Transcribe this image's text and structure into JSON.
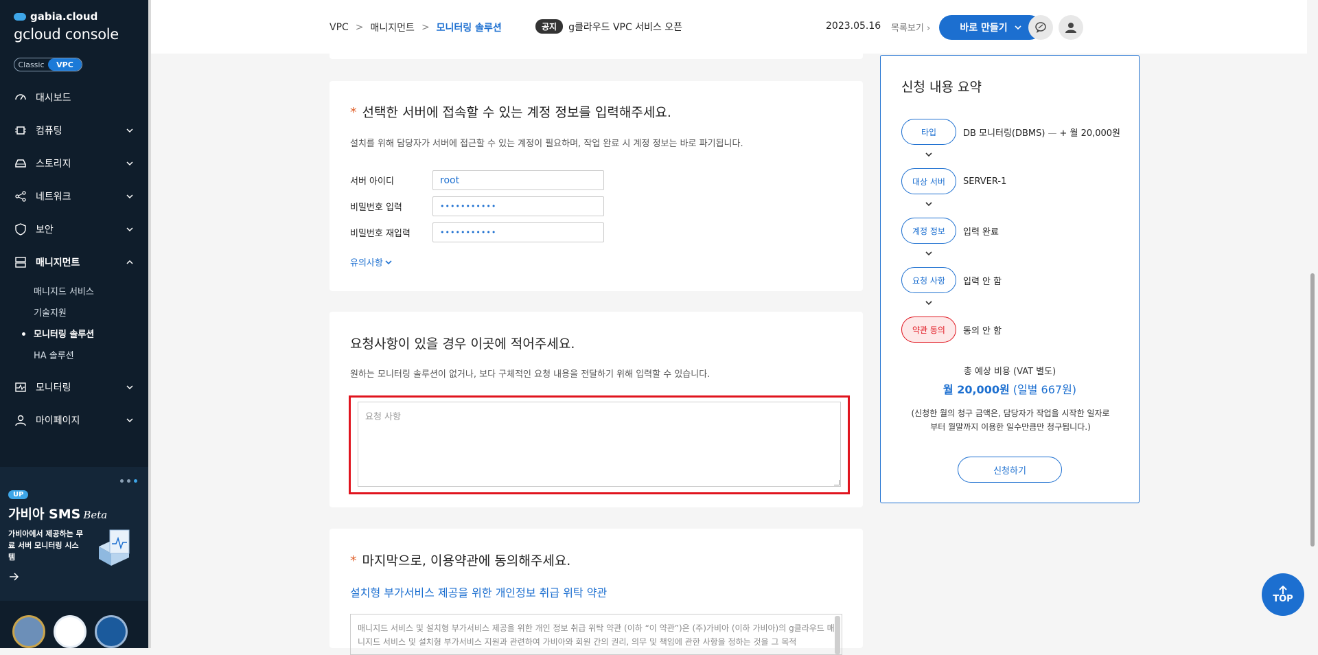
{
  "sidebar": {
    "brand": "gabia.cloud",
    "console": "gcloud console",
    "toggle": {
      "classic": "Classic",
      "vpc": "VPC"
    },
    "nav": {
      "dashboard": "대시보드",
      "computing": "컴퓨팅",
      "storage": "스토리지",
      "network": "네트워크",
      "security": "보안",
      "managed": "매니지먼트",
      "monitoring": "모니터링",
      "mypage": "마이페이지"
    },
    "sub": {
      "managed_service": "매니지드 서비스",
      "tech_support": "기술지원",
      "monitoring_solution": "모니터링 솔루션",
      "ha_solution": "HA 솔루션"
    },
    "promo": {
      "badge": "UP",
      "title": "가비아 SMS",
      "title_suffix": "Beta",
      "desc": "가비아에서 제공하는 무료 서버 모니터링 시스템"
    }
  },
  "topbar": {
    "breadcrumb": {
      "vpc": "VPC",
      "management": "매니지먼트",
      "current": "모니터링 솔루션",
      "sep": ">"
    },
    "notice_tag": "공지",
    "notice_text": "g클라우드 VPC 서비스 오픈",
    "date": "2023.05.16",
    "list_link": "목록보기",
    "make_button": "바로 만들기"
  },
  "account": {
    "title": "선택한 서버에 접속할 수 있는 계정 정보를 입력해주세요.",
    "required_mark": "*",
    "desc": "설치를 위해 담당자가 서버에 접근할 수 있는 계정이 필요하며, 작업 완료 시 계정 정보는 바로 파기됩니다.",
    "server_id_label": "서버 아이디",
    "server_id_value": "root",
    "password_label": "비밀번호 입력",
    "password_value": "•••••••••••",
    "password_confirm_label": "비밀번호 재입력",
    "password_confirm_value": "•••••••••••",
    "notes_link": "유의사항"
  },
  "request": {
    "title": "요청사항이 있을 경우 이곳에 적어주세요.",
    "desc": "원하는 모니터링 솔루션이 없거나, 보다 구체적인 요청 내용을 전달하기 위해 입력할 수 있습니다.",
    "placeholder": "요청 사항"
  },
  "terms": {
    "required_mark": "*",
    "title": "마지막으로, 이용약관에 동의해주세요.",
    "link": "설치형 부가서비스 제공을 위한 개인정보 취급 위탁 약관",
    "text": "매니지드 서비스 및 설치형 부가서비스 제공을 위한 개인 정보 취급 위탁 약관 (이하 “이 약관”)은 (주)가비아 (이하 가비아)의 g클라우드 매니지드 서비스 및 설치형 부가서비스 지원과 관련하여 가비아와 회원 간의 권리, 의무 및 책임에 관한 사항을 정하는 것을 그 목적"
  },
  "summary": {
    "title": "신청 내용 요약",
    "steps": [
      {
        "label": "타입",
        "value": "DB 모니터링(DBMS)",
        "extra": "+ 월 20,000원"
      },
      {
        "label": "대상 서버",
        "value": "SERVER-1"
      },
      {
        "label": "계정 정보",
        "value": "입력 완료"
      },
      {
        "label": "요청 사항",
        "value": "입력 안 함"
      },
      {
        "label": "약관 동의",
        "value": "동의 안 함"
      }
    ],
    "total_label": "총 예상 비용 (VAT 별도)",
    "total_value": "월 20,000원",
    "total_daily": "(일별 667원)",
    "billing_note": "(신청한 월의 청구 금액은, 담당자가 작업을 시작한 일자로부터 월말까지 이용한 일수만큼만 청구됩니다.)",
    "apply_button": "신청하기"
  },
  "top_button": "TOP"
}
